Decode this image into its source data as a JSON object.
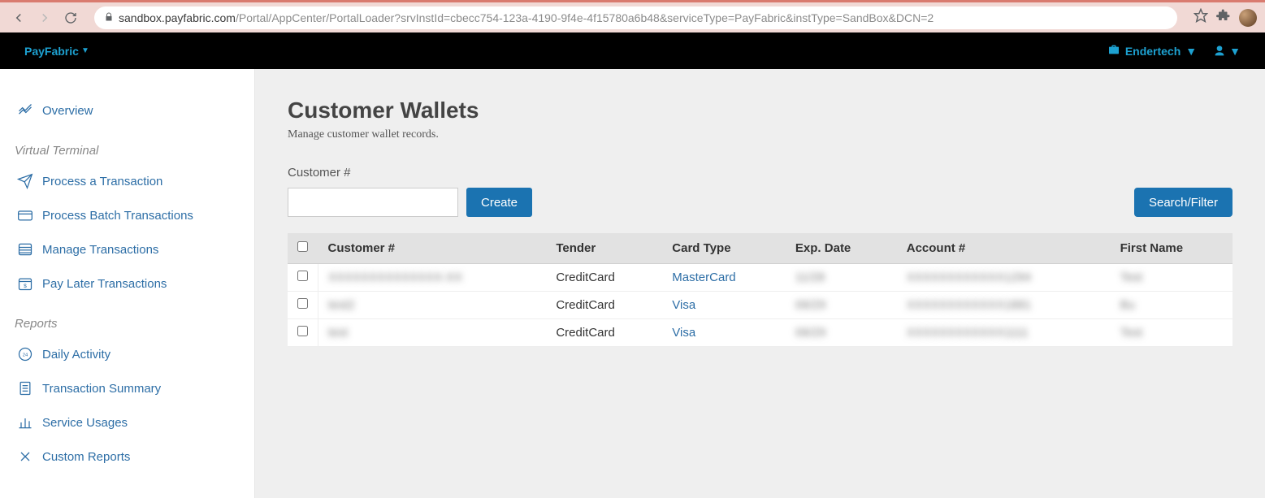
{
  "browser": {
    "url_host": "sandbox.payfabric.com",
    "url_path": "/Portal/AppCenter/PortalLoader?srvInstId=cbecc754-123a-4190-9f4e-4f15780a6b48&serviceType=PayFabric&instType=SandBox&DCN=2"
  },
  "topbar": {
    "brand": "PayFabric",
    "account": "Endertech"
  },
  "sidebar": {
    "overview": "Overview",
    "group_vt": "Virtual Terminal",
    "process_txn": "Process a Transaction",
    "process_batch": "Process Batch Transactions",
    "manage_txn": "Manage Transactions",
    "pay_later": "Pay Later Transactions",
    "group_reports": "Reports",
    "daily_activity": "Daily Activity",
    "txn_summary": "Transaction Summary",
    "service_usages": "Service Usages",
    "custom_reports": "Custom Reports"
  },
  "page": {
    "title": "Customer Wallets",
    "subtitle": "Manage customer wallet records.",
    "customer_label": "Customer #",
    "create_btn": "Create",
    "search_btn": "Search/Filter"
  },
  "table": {
    "h_customer": "Customer #",
    "h_tender": "Tender",
    "h_cardtype": "Card Type",
    "h_exp": "Exp. Date",
    "h_account": "Account #",
    "h_firstname": "First Name",
    "rows": [
      {
        "customer": "XXXXXXXXXXXXXX-XX",
        "tender": "CreditCard",
        "cardtype": "MasterCard",
        "exp": "11/28",
        "account": "XXXXXXXXXXXX1294",
        "firstname": "Test"
      },
      {
        "customer": "test2",
        "tender": "CreditCard",
        "cardtype": "Visa",
        "exp": "06/29",
        "account": "XXXXXXXXXXXX1881",
        "firstname": "Bu"
      },
      {
        "customer": "test",
        "tender": "CreditCard",
        "cardtype": "Visa",
        "exp": "06/29",
        "account": "XXXXXXXXXXXX1111",
        "firstname": "Test"
      }
    ]
  }
}
